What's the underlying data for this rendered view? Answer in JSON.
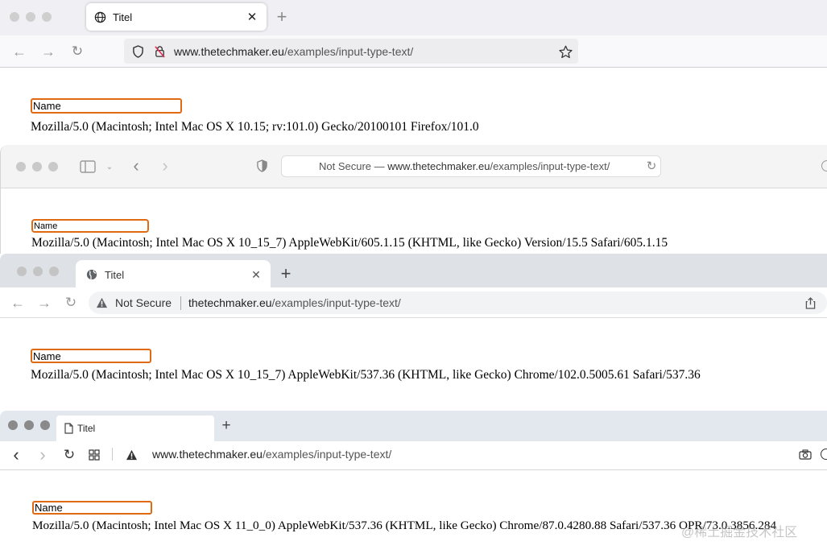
{
  "firefox": {
    "tab_title": "Titel",
    "url_host": "www.thetechmaker.eu",
    "url_path": "/examples/input-type-text/",
    "input_value": "Name",
    "user_agent": "Mozilla/5.0 (Macintosh; Intel Mac OS X 10.15; rv:101.0) Gecko/20100101 Firefox/101.0"
  },
  "safari": {
    "url_prefix": "Not Secure — ",
    "url_host": "www.thetechmaker.eu",
    "url_path": "/examples/input-type-text/",
    "input_value": "Name",
    "user_agent": "Mozilla/5.0 (Macintosh; Intel Mac OS X 10_15_7) AppleWebKit/605.1.15 (KHTML, like Gecko) Version/15.5 Safari/605.1.15"
  },
  "chrome": {
    "tab_title": "Titel",
    "security_label": "Not Secure",
    "url_host": "thetechmaker.eu",
    "url_path": "/examples/input-type-text/",
    "input_value": "Name",
    "user_agent": "Mozilla/5.0 (Macintosh; Intel Mac OS X 10_15_7) AppleWebKit/537.36 (KHTML, like Gecko) Chrome/102.0.5005.61 Safari/537.36"
  },
  "opera": {
    "tab_title": "Titel",
    "url_host": "www.thetechmaker.eu",
    "url_path": "/examples/input-type-text/",
    "input_value": "Name",
    "user_agent": "Mozilla/5.0 (Macintosh; Intel Mac OS X 11_0_0) AppleWebKit/537.36 (KHTML, like Gecko) Chrome/87.0.4280.88 Safari/537.36 OPR/73.0.3856.284"
  },
  "watermark": "@稀土掘金技术社区",
  "colors": {
    "input_border": "#e06a12",
    "traffic_grey": "#c9c9c9"
  }
}
